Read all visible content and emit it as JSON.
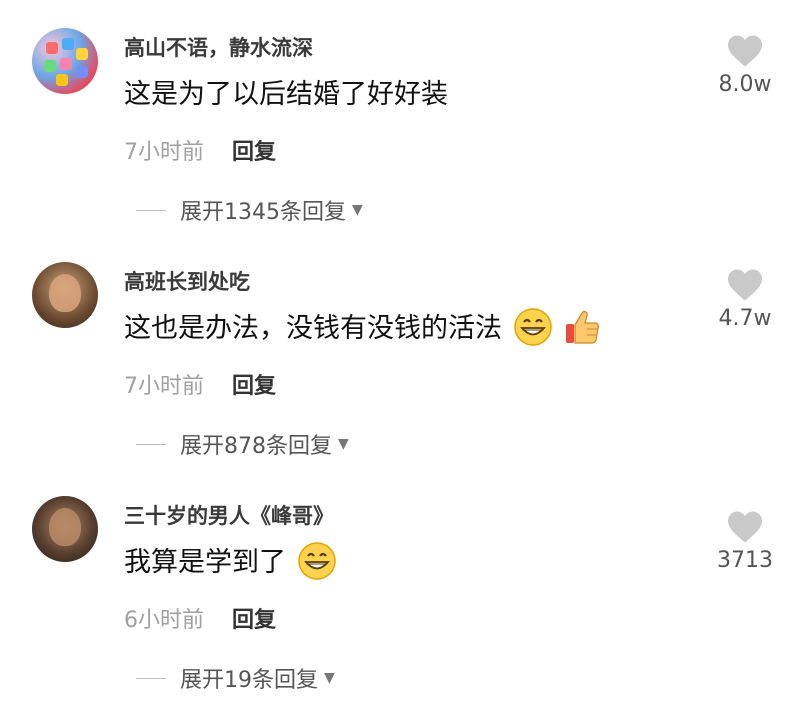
{
  "comments": [
    {
      "username": "高山不语，静水流深",
      "text": "这是为了以后结婚了好好装",
      "time": "7小时前",
      "reply_label": "回复",
      "expand_label": "展开1345条回复",
      "likes": "8.0w",
      "emojis": []
    },
    {
      "username": "高班长到处吃",
      "text": "这也是办法，没钱有没钱的活法",
      "time": "7小时前",
      "reply_label": "回复",
      "expand_label": "展开878条回复",
      "likes": "4.7w",
      "emojis": [
        "grinning-face-icon",
        "thumbs-up-icon"
      ]
    },
    {
      "username": "三十岁的男人《峰哥》",
      "text": "我算是学到了",
      "time": "6小时前",
      "reply_label": "回复",
      "expand_label": "展开19条回复",
      "likes": "3713",
      "emojis": [
        "grinning-face-icon"
      ]
    }
  ]
}
